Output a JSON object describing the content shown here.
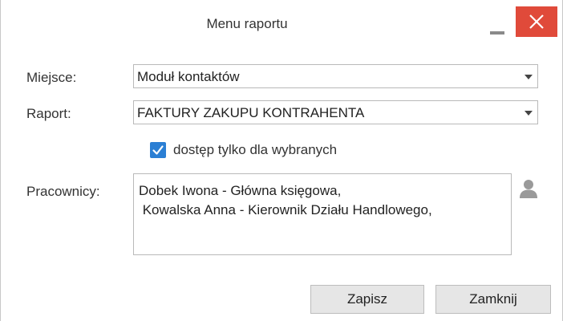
{
  "window": {
    "title": "Menu raportu"
  },
  "form": {
    "place_label": "Miejsce:",
    "place_value": "Moduł kontaktów",
    "report_label": "Raport:",
    "report_value": "FAKTURY ZAKUPU KONTRAHENTA",
    "access_checkbox_label": "dostęp tylko dla wybranych",
    "access_checked": true,
    "employees_label": "Pracownicy:",
    "employees_lines": [
      "Dobek Iwona - Główna księgowa,",
      " Kowalska Anna - Kierownik Działu Handlowego,"
    ]
  },
  "buttons": {
    "save_label": "Zapisz",
    "close_label": "Zamknij"
  },
  "icons": {
    "minimize": "minimize-icon",
    "close": "close-icon",
    "dropdown": "chevron-down-icon",
    "check": "check-icon",
    "user": "user-icon"
  },
  "colors": {
    "close_button": "#e04a3a",
    "checkbox": "#2b7fd4",
    "button_bg": "#e6e6e6"
  }
}
